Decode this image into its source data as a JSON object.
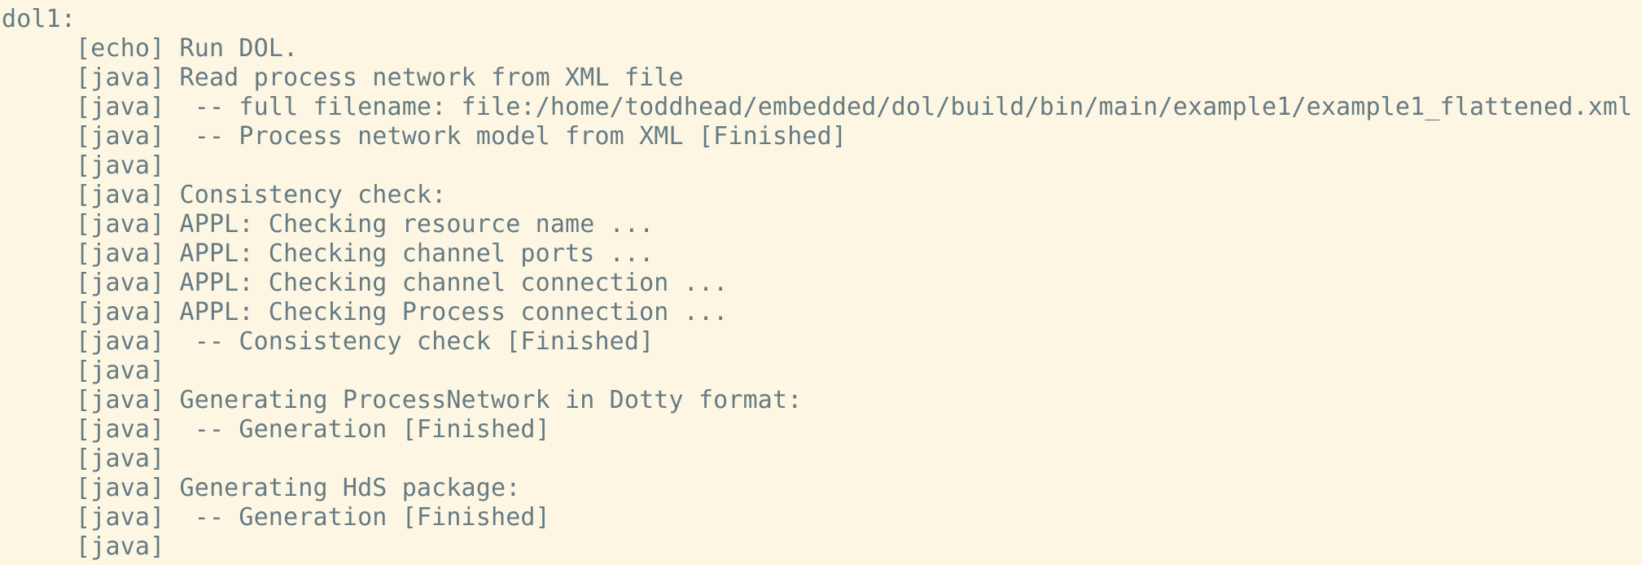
{
  "terminal": {
    "lines": [
      "dol1:",
      "     [echo] Run DOL.",
      "     [java] Read process network from XML file",
      "     [java]  -- full filename: file:/home/toddhead/embedded/dol/build/bin/main/example1/example1_flattened.xml",
      "     [java]  -- Process network model from XML [Finished]",
      "     [java]",
      "     [java] Consistency check:",
      "     [java] APPL: Checking resource name ...",
      "     [java] APPL: Checking channel ports ...",
      "     [java] APPL: Checking channel connection ...",
      "     [java] APPL: Checking Process connection ...",
      "     [java]  -- Consistency check [Finished]",
      "     [java]",
      "     [java] Generating ProcessNetwork in Dotty format:",
      "     [java]  -- Generation [Finished]",
      "     [java]",
      "     [java] Generating HdS package:",
      "     [java]  -- Generation [Finished]",
      "     [java]"
    ]
  }
}
